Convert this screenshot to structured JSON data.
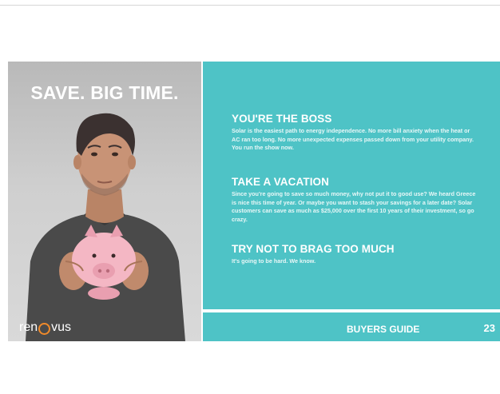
{
  "photo": {
    "headline": "SAVE. BIG TIME.",
    "logo_left": "ren",
    "logo_right": "vus"
  },
  "sections": [
    {
      "heading": "YOU'RE THE BOSS",
      "body": "Solar is the easiest path to energy independence. No more bill anxiety when the heat or AC ran too long. No more unexpected expenses passed down from your utility company. You run the show now."
    },
    {
      "heading": "TAKE A VACATION",
      "body": "Since you're going to save so much money, why not put it to good use? We heard Greece is nice this time of year. Or maybe you want to stash your savings for a later date? Solar customers can save as much as $25,000 over the first 10 years of their investment, so go crazy."
    },
    {
      "heading": "TRY NOT TO BRAG TOO MUCH",
      "body": "It's going to be hard. We know."
    }
  ],
  "footer": {
    "label": "BUYERS GUIDE",
    "page_number": "23"
  },
  "colors": {
    "accent_teal": "#4ec3c6",
    "logo_orange": "#f08a2a",
    "piggy_pink": "#f4b7c4"
  }
}
